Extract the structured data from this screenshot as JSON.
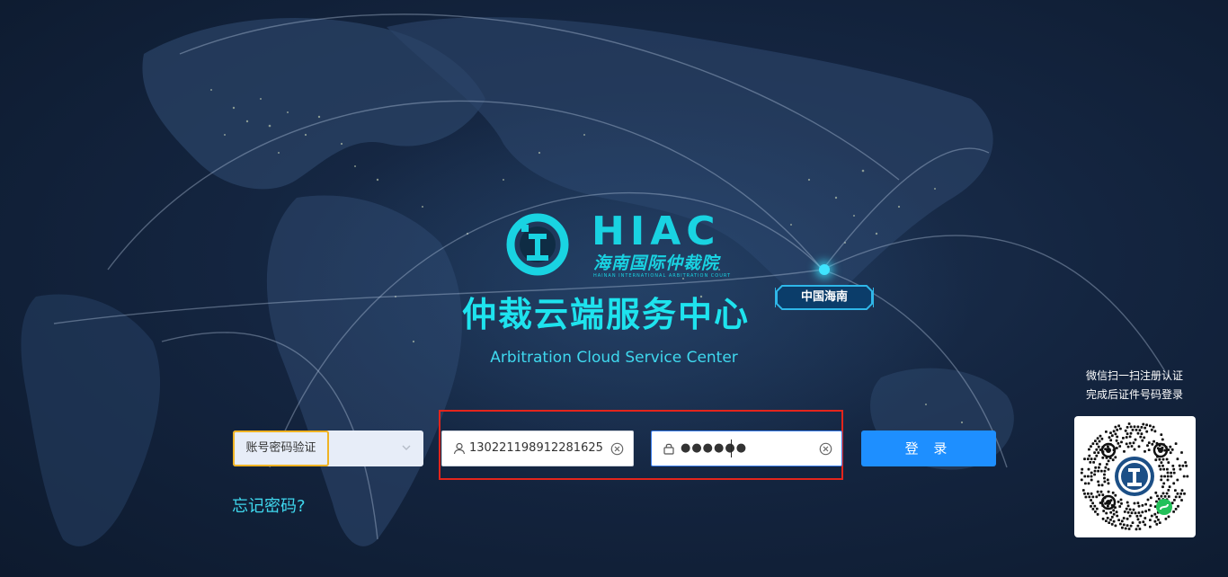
{
  "brand": {
    "abbr": "HIAC",
    "name_cn": "海南国际仲裁院",
    "name_en": "HAINAN INTERNATIONAL ARBITRATION COURT",
    "accent_color": "#19d3e2"
  },
  "hero": {
    "title": "仲裁云端服务中心",
    "subtitle": "Arbitration Cloud Service Center",
    "region_badge": "中国海南"
  },
  "login_form": {
    "auth_method": {
      "selected": "账号密码验证"
    },
    "username": {
      "value": "130221198912281625"
    },
    "password": {
      "masked_value": "●●●●●●"
    },
    "submit_label": "登 录",
    "forgot_password": "忘记密码?"
  },
  "qr_login": {
    "hint_line1": "微信扫一扫注册认证",
    "hint_line2": "完成后证件号码登录"
  },
  "icons": {
    "username": "user-icon",
    "password": "lock-icon",
    "clear": "clear-circle-icon",
    "dropdown": "chevron-down-icon",
    "qr": "wechat-mini-program-code"
  },
  "colors": {
    "primary_button": "#1e8fff",
    "highlight_border": "#e3251c",
    "select_focus_border": "#f0b323",
    "text_cyan": "#3fd8ee"
  }
}
